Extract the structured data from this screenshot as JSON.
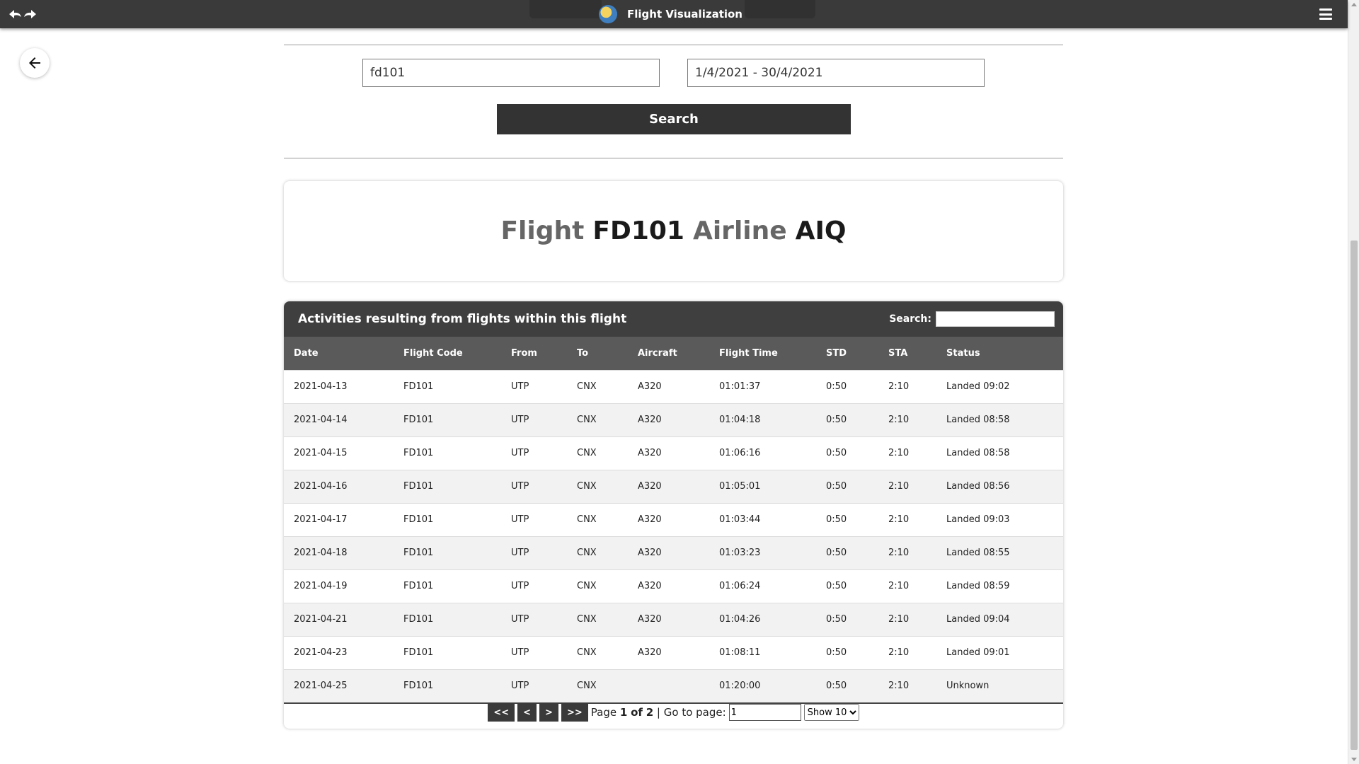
{
  "app": {
    "title": "Flight Visualization"
  },
  "search": {
    "flight_value": "fd101",
    "date_range_value": "1/4/2021 - 30/4/2021",
    "button_label": "Search"
  },
  "flight_header": {
    "flight_label": "Flight",
    "flight_code": "FD101",
    "airline_label": "Airline",
    "airline_code": "AIQ"
  },
  "table": {
    "title": "Activities resulting from flights within this flight",
    "search_label": "Search:",
    "columns": [
      "Date",
      "Flight Code",
      "From",
      "To",
      "Aircraft",
      "Flight Time",
      "STD",
      "STA",
      "Status"
    ],
    "rows": [
      [
        "2021-04-13",
        "FD101",
        "UTP",
        "CNX",
        "A320",
        "01:01:37",
        "0:50",
        "2:10",
        "Landed 09:02"
      ],
      [
        "2021-04-14",
        "FD101",
        "UTP",
        "CNX",
        "A320",
        "01:04:18",
        "0:50",
        "2:10",
        "Landed 08:58"
      ],
      [
        "2021-04-15",
        "FD101",
        "UTP",
        "CNX",
        "A320",
        "01:06:16",
        "0:50",
        "2:10",
        "Landed 08:58"
      ],
      [
        "2021-04-16",
        "FD101",
        "UTP",
        "CNX",
        "A320",
        "01:05:01",
        "0:50",
        "2:10",
        "Landed 08:56"
      ],
      [
        "2021-04-17",
        "FD101",
        "UTP",
        "CNX",
        "A320",
        "01:03:44",
        "0:50",
        "2:10",
        "Landed 09:03"
      ],
      [
        "2021-04-18",
        "FD101",
        "UTP",
        "CNX",
        "A320",
        "01:03:23",
        "0:50",
        "2:10",
        "Landed 08:55"
      ],
      [
        "2021-04-19",
        "FD101",
        "UTP",
        "CNX",
        "A320",
        "01:06:24",
        "0:50",
        "2:10",
        "Landed 08:59"
      ],
      [
        "2021-04-21",
        "FD101",
        "UTP",
        "CNX",
        "A320",
        "01:04:26",
        "0:50",
        "2:10",
        "Landed 09:04"
      ],
      [
        "2021-04-23",
        "FD101",
        "UTP",
        "CNX",
        "A320",
        "01:08:11",
        "0:50",
        "2:10",
        "Landed 09:01"
      ],
      [
        "2021-04-25",
        "FD101",
        "UTP",
        "CNX",
        "",
        "01:20:00",
        "0:50",
        "2:10",
        "Unknown"
      ]
    ]
  },
  "pagination": {
    "first_label": "<<",
    "prev_label": "<",
    "next_label": ">",
    "last_label": ">>",
    "page_prefix": "Page",
    "current_page": "1",
    "of_label": "of",
    "total_pages": "2",
    "goto_label": "| Go to page:",
    "goto_value": "1",
    "show_value": "Show 10"
  },
  "icons": {
    "nav": "undo-redo-icon",
    "logo": "globe-logo-icon",
    "menu": "hamburger-menu-icon",
    "back": "arrow-left-icon"
  }
}
